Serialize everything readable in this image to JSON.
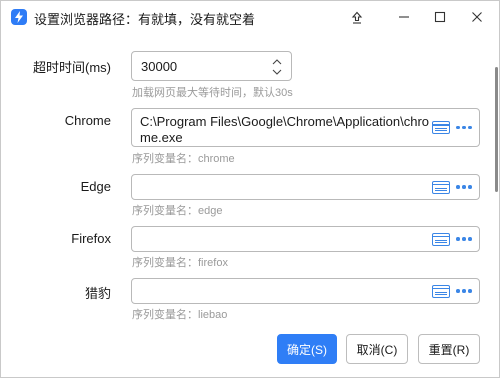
{
  "window": {
    "title": "设置浏览器路径：有就填，没有就空着",
    "icons": {
      "app": "lightning-icon",
      "pin": "pin-icon",
      "minimize": "minimize-icon",
      "maximize": "maximize-icon",
      "close": "close-icon"
    }
  },
  "timeout": {
    "label": "超时时间(ms)",
    "value": "30000",
    "hint": "加载网页最大等待时间，默认30s"
  },
  "browsers": [
    {
      "label": "Chrome",
      "value": "C:\\Program Files\\Google\\Chrome\\Application\\chrome.exe",
      "hint": "序列变量名：chrome"
    },
    {
      "label": "Edge",
      "value": "",
      "hint": "序列变量名：edge"
    },
    {
      "label": "Firefox",
      "value": "",
      "hint": "序列变量名：firefox"
    },
    {
      "label": "猎豹",
      "value": "",
      "hint": "序列变量名：liebao"
    }
  ],
  "buttons": {
    "confirm": "确定(S)",
    "cancel": "取消(C)",
    "reset": "重置(R)"
  },
  "colors": {
    "accent": "#2f7ef6",
    "hint_text": "#9a9a9a"
  }
}
